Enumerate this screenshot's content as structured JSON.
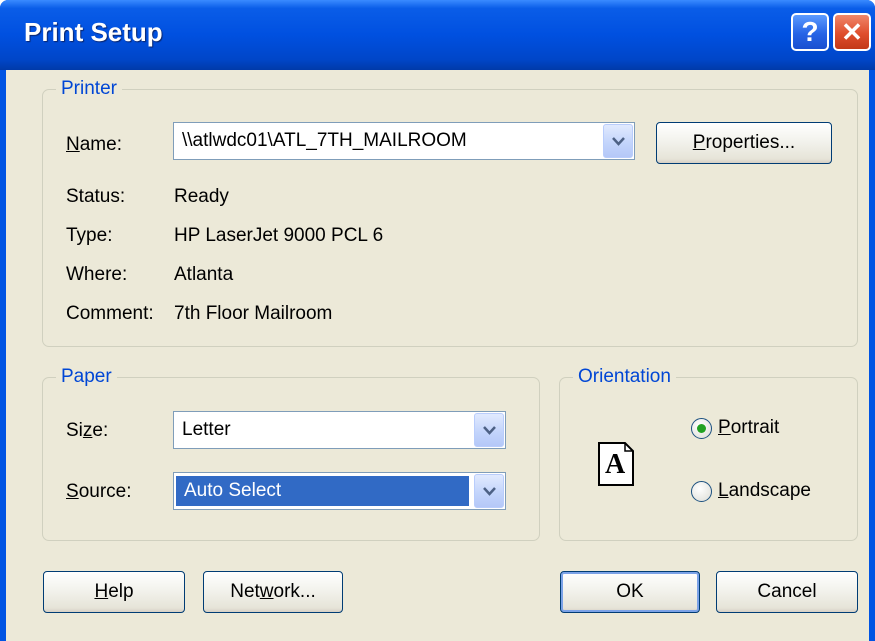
{
  "window": {
    "title": "Print Setup",
    "help_glyph": "?",
    "close_glyph": "✕"
  },
  "printer": {
    "legend": "Printer",
    "name_label_pre": "",
    "name_label_u": "N",
    "name_label_post": "ame:",
    "name_value": "\\\\atlwdc01\\ATL_7TH_MAILROOM",
    "properties_button": {
      "u": "P",
      "post": "roperties..."
    },
    "status_label": "Status:",
    "status_value": "Ready",
    "type_label": "Type:",
    "type_value": "HP LaserJet 9000 PCL 6",
    "where_label": "Where:",
    "where_value": "Atlanta",
    "comment_label": "Comment:",
    "comment_value": "7th Floor Mailroom"
  },
  "paper": {
    "legend": "Paper",
    "size_label_pre": "Si",
    "size_label_u": "z",
    "size_label_post": "e:",
    "size_value": "Letter",
    "source_label_pre": "",
    "source_label_u": "S",
    "source_label_post": "ource:",
    "source_value": "Auto Select"
  },
  "orientation": {
    "legend": "Orientation",
    "page_icon_letter": "A",
    "portrait": {
      "pre": "",
      "u": "P",
      "post": "ortrait",
      "checked": true
    },
    "landscape": {
      "pre": "",
      "u": "L",
      "post": "andscape",
      "checked": false
    }
  },
  "buttons": {
    "help": {
      "pre": "",
      "u": "H",
      "post": "elp"
    },
    "network": {
      "pre": "Net",
      "u": "w",
      "post": "ork..."
    },
    "ok": "OK",
    "cancel": "Cancel"
  },
  "colors": {
    "title_bar": "#0054e3",
    "dialog_face": "#ece9d8",
    "group_label": "#0046d5",
    "selection": "#316ac5",
    "radio_dot": "#21a121"
  }
}
